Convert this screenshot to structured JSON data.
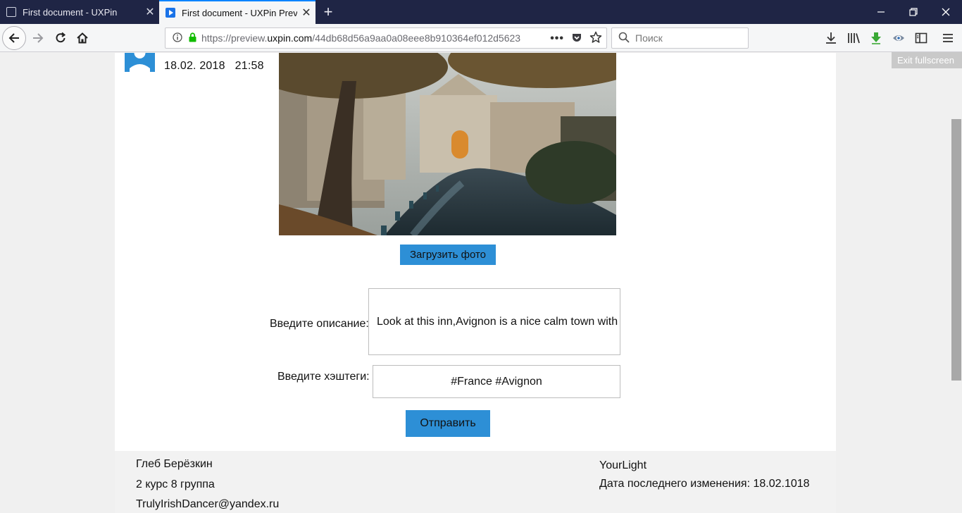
{
  "browser": {
    "tabs": [
      {
        "title": "First document - UXPin",
        "active": false
      },
      {
        "title": "First document - UXPin Preview",
        "active": true
      }
    ],
    "url_prefix": "https://preview.",
    "url_domain": "uxpin.com",
    "url_rest": "/44db68d56a9aa0a08eee8b910364ef012d5623",
    "search_placeholder": "Поиск",
    "exit_fullscreen": "Exit fullscreen",
    "accent_color": "#0a84ff"
  },
  "post": {
    "datetime": "18.02. 2018   21:58",
    "upload_label": "Загрузить фото",
    "description_label": "Введите описание:",
    "description_value": "Look at this inn,Avignon is a nice calm town with",
    "hashtags_label": "Введите хэштеги:",
    "hashtags_value": "#France #Avignon",
    "send_label": "Отправить",
    "button_color": "#2d8fd6"
  },
  "footer": {
    "name": "Глеб Берёзкин",
    "group": "2 курс 8 группа",
    "email": "TrulyIrishDancer@yandex.ru",
    "brand": "YourLight",
    "last_modified": "Дата последнего изменения: 18.02.1018"
  }
}
